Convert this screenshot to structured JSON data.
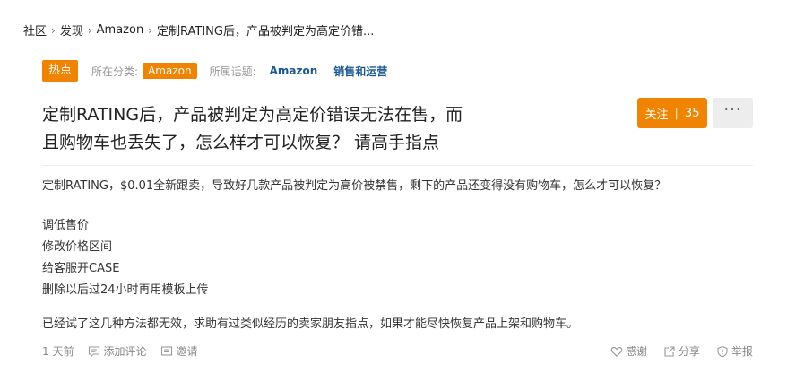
{
  "breadcrumb": {
    "items": [
      "社区",
      "发现",
      "Amazon"
    ],
    "current": "定制RATING后，产品被判定为高定价错...",
    "separator": "›"
  },
  "meta": {
    "hot_badge": "热点",
    "category_label": "所在分类:",
    "category_tag": "Amazon",
    "topic_label": "所属话题:",
    "topics": [
      "Amazon",
      "销售和运营"
    ]
  },
  "question": {
    "title_line1": "定制RATING后，产品被判定为高定价错误无法在售，而",
    "title_line2": "且购物车也丢失了，怎么样才可以恢复？ 请高手指点"
  },
  "actions": {
    "follow_label": "关注",
    "follow_count": "35",
    "more_label": "···"
  },
  "content": {
    "paragraph1": "定制RATING，$0.01全新跟卖，导致好几款产品被判定为高价被禁售，剩下的产品还变得没有购物车，怎么才可以恢复？",
    "list": [
      "调低售价",
      "修改价格区间",
      "给客服开CASE",
      "删除以后过24小时再用模板上传"
    ],
    "paragraph2": "已经试了这几种方法都无效，求助有过类似经历的卖家朋友指点，如果才能尽快恢复产品上架和购物车。"
  },
  "footer": {
    "time": "1 天前",
    "comment": "添加评论",
    "invite": "邀请",
    "thanks": "感谢",
    "share": "分享",
    "report": "举报"
  },
  "colors": {
    "accent": "#f08300",
    "topic": "#1b5790"
  }
}
